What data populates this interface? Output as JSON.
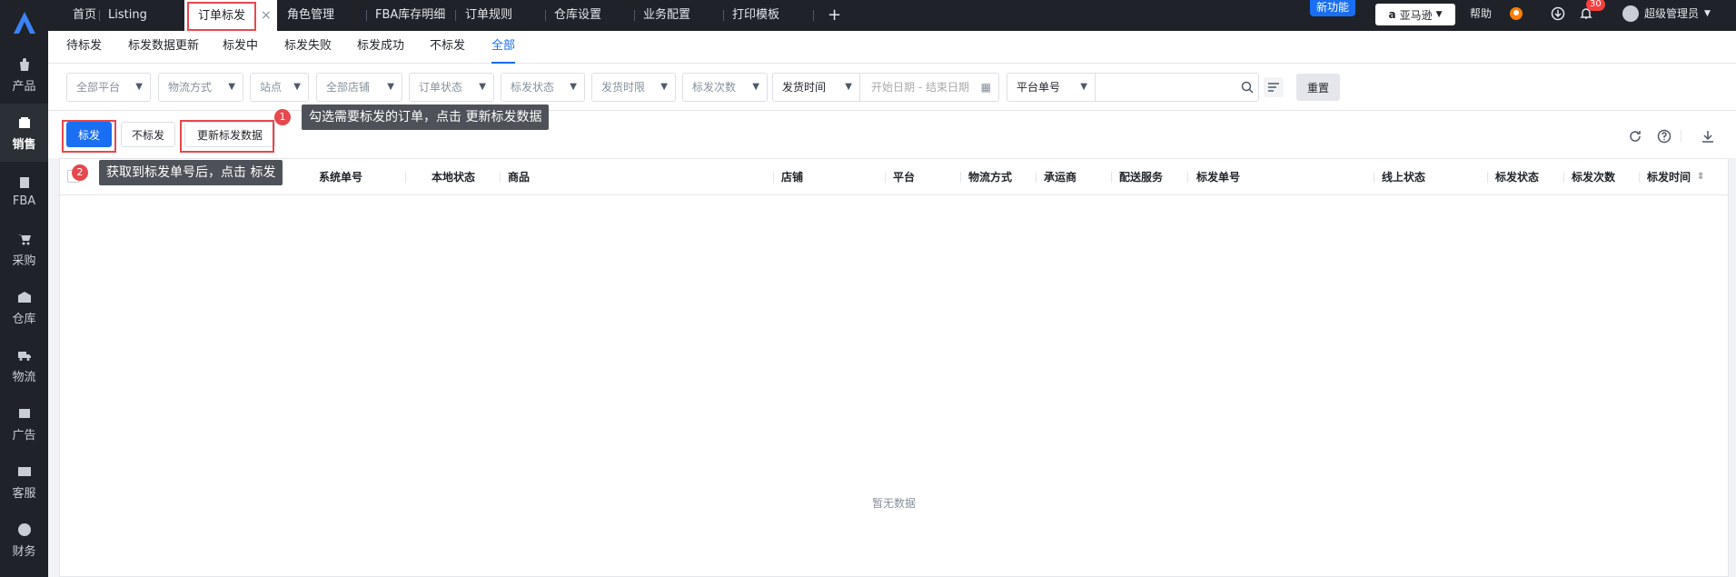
{
  "sidebar": {
    "items": [
      {
        "label": "产品",
        "icon": "bag-icon"
      },
      {
        "label": "销售",
        "icon": "sell-icon"
      },
      {
        "label": "FBA",
        "icon": "fba-icon"
      },
      {
        "label": "采购",
        "icon": "cart-icon"
      },
      {
        "label": "仓库",
        "icon": "warehouse-icon"
      },
      {
        "label": "物流",
        "icon": "truck-icon"
      },
      {
        "label": "广告",
        "icon": "ad-icon"
      },
      {
        "label": "客服",
        "icon": "mail-icon"
      },
      {
        "label": "财务",
        "icon": "yen-icon"
      }
    ]
  },
  "topbar": {
    "tabs": [
      "首页",
      "Listing",
      "订单标发",
      "角色管理",
      "FBA库存明细",
      "订单规则",
      "仓库设置",
      "业务配置",
      "打印模板"
    ],
    "close_glyph": "×",
    "plus_glyph": "+",
    "new_feature": "新功能",
    "shop": "亚马逊",
    "help": "帮助",
    "notification_count": "30",
    "user": "超级管理员"
  },
  "subtabs": [
    "待标发",
    "标发数据更新",
    "标发中",
    "标发失败",
    "标发成功",
    "不标发",
    "全部"
  ],
  "filters": {
    "platform": "全部平台",
    "shipping_method": "物流方式",
    "site": "站点",
    "shop": "全部店铺",
    "order_status": "订单状态",
    "mark_status": "标发状态",
    "ship_deadline": "发货时限",
    "mark_count": "标发次数",
    "ship_time": "发货时间",
    "date_start": "开始日期",
    "date_sep": "-",
    "date_end": "结束日期",
    "order_type": "平台单号",
    "search_value": "",
    "reset": "重置"
  },
  "actions": {
    "mark": "标发",
    "no_mark": "不标发",
    "update": "更新标发数据"
  },
  "tooltips": {
    "step1_num": "1",
    "step1": "勾选需要标发的订单，点击 更新标发数据",
    "step2_num": "2",
    "step2": "获取到标发单号后，点击 标发"
  },
  "table": {
    "columns": [
      "系统单号",
      "本地状态",
      "商品",
      "店铺",
      "平台",
      "物流方式",
      "承运商",
      "配送服务",
      "标发单号",
      "线上状态",
      "标发状态",
      "标发次数",
      "标发时间"
    ],
    "empty": "暂无数据"
  },
  "colors": {
    "sidebar_bg": "#1f2329",
    "primary": "#1a6ef2",
    "highlight_red": "#e5484d"
  }
}
